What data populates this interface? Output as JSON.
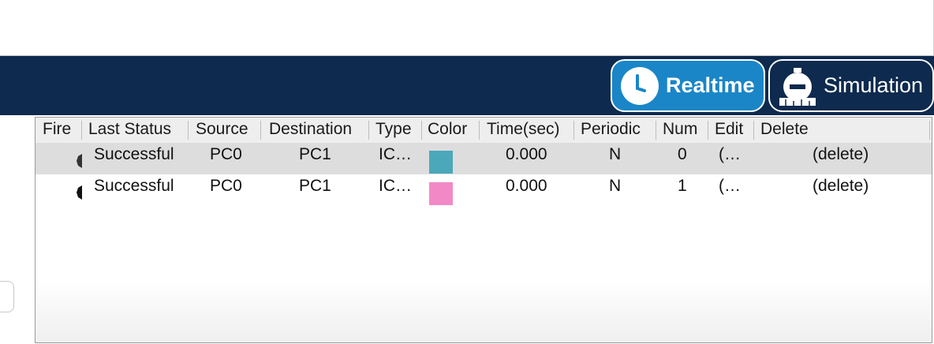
{
  "mode_bar": {
    "realtime_label": "Realtime",
    "simulation_label": "Simulation",
    "realtime_icon": "clock-icon",
    "simulation_icon": "stopwatch-icon"
  },
  "colors": {
    "mode_bar_bg": "#0e2a4e",
    "realtime_active": "#1a86c7"
  },
  "table": {
    "columns": [
      "Fire",
      "Last Status",
      "Source",
      "Destination",
      "Type",
      "Color",
      "Time(sec)",
      "Periodic",
      "Num",
      "Edit",
      "Delete"
    ],
    "rows": [
      {
        "fire": "",
        "last_status": "Successful",
        "source": "PC0",
        "destination": "PC1",
        "type": "IC…",
        "color": "#4ba8bb",
        "time": "0.000",
        "periodic": "N",
        "num": "0",
        "edit": "(…",
        "delete": "(delete)"
      },
      {
        "fire": "",
        "last_status": "Successful",
        "source": "PC0",
        "destination": "PC1",
        "type": "IC…",
        "color": "#f289c6",
        "time": "0.000",
        "periodic": "N",
        "num": "1",
        "edit": "(…",
        "delete": "(delete)"
      }
    ]
  }
}
